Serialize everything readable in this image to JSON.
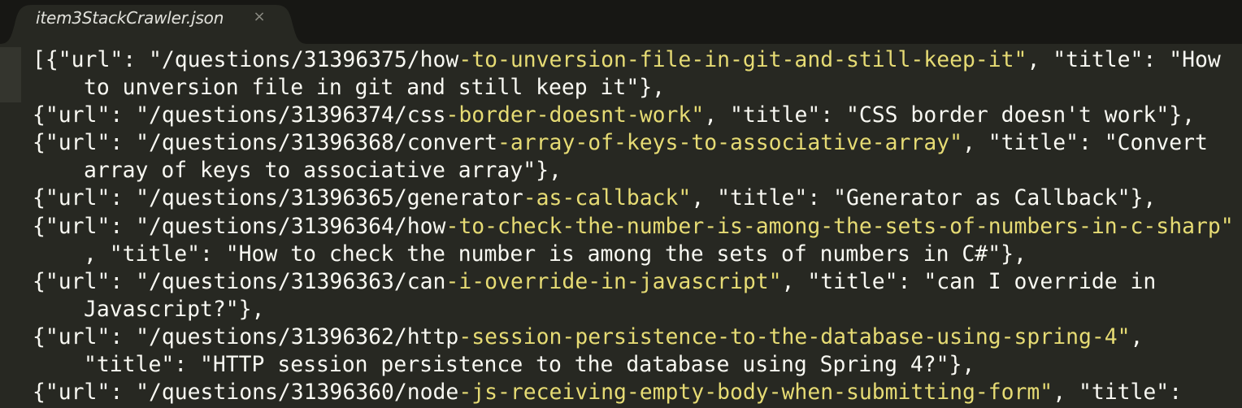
{
  "tab": {
    "title": "item3StackCrawler.json",
    "close_glyph": "×",
    "close_icon": "close-icon"
  },
  "colors": {
    "background": "#272822",
    "tabbar": "#171714",
    "text": "#f8f8f2",
    "string_highlight": "#e6db74"
  },
  "editor": {
    "lines": [
      {
        "segments": [
          {
            "t": "[{\"url\": \"/questions/31396375/how",
            "c": "punc"
          },
          {
            "t": "-to-unversion-file-in-git-and-still-keep-it\"",
            "c": "str"
          },
          {
            "t": ", \"title\": \"How",
            "c": "punc"
          }
        ]
      },
      {
        "indent": true,
        "segments": [
          {
            "t": "to unversion file in git and still keep it\"},",
            "c": "punc"
          }
        ]
      },
      {
        "segments": [
          {
            "t": "{\"url\": \"/questions/31396374/css",
            "c": "punc"
          },
          {
            "t": "-border-doesnt-work\"",
            "c": "str"
          },
          {
            "t": ", \"title\": \"CSS border doesn't work\"},",
            "c": "punc"
          }
        ]
      },
      {
        "segments": [
          {
            "t": "{\"url\": \"/questions/31396368/convert",
            "c": "punc"
          },
          {
            "t": "-array-of-keys-to-associative-array\"",
            "c": "str"
          },
          {
            "t": ", \"title\": \"Convert",
            "c": "punc"
          }
        ]
      },
      {
        "indent": true,
        "segments": [
          {
            "t": "array of keys to associative array\"},",
            "c": "punc"
          }
        ]
      },
      {
        "segments": [
          {
            "t": "{\"url\": \"/questions/31396365/generator",
            "c": "punc"
          },
          {
            "t": "-as-callback\"",
            "c": "str"
          },
          {
            "t": ", \"title\": \"Generator as Callback\"},",
            "c": "punc"
          }
        ]
      },
      {
        "segments": [
          {
            "t": "{\"url\": \"/questions/31396364/how",
            "c": "punc"
          },
          {
            "t": "-to-check-the-number-is-among-the-sets-of-numbers-in-c-sharp\"",
            "c": "str"
          }
        ]
      },
      {
        "indent": true,
        "segments": [
          {
            "t": ", \"title\": \"How to check the number is among the sets of numbers in C#\"},",
            "c": "punc"
          }
        ]
      },
      {
        "segments": [
          {
            "t": "{\"url\": \"/questions/31396363/can",
            "c": "punc"
          },
          {
            "t": "-i-override-in-javascript\"",
            "c": "str"
          },
          {
            "t": ", \"title\": \"can I override in",
            "c": "punc"
          }
        ]
      },
      {
        "indent": true,
        "segments": [
          {
            "t": "Javascript?\"},",
            "c": "punc"
          }
        ]
      },
      {
        "segments": [
          {
            "t": "{\"url\": \"/questions/31396362/http",
            "c": "punc"
          },
          {
            "t": "-session-persistence-to-the-database-using-spring-4\"",
            "c": "str"
          },
          {
            "t": ",",
            "c": "punc"
          }
        ]
      },
      {
        "indent": true,
        "segments": [
          {
            "t": "\"title\": \"HTTP session persistence to the database using Spring 4?\"},",
            "c": "punc"
          }
        ]
      },
      {
        "segments": [
          {
            "t": "{\"url\": \"/questions/31396360/node",
            "c": "punc"
          },
          {
            "t": "-js-receiving-empty-body-when-submitting-form\"",
            "c": "str"
          },
          {
            "t": ", \"title\":",
            "c": "punc"
          }
        ]
      }
    ]
  }
}
